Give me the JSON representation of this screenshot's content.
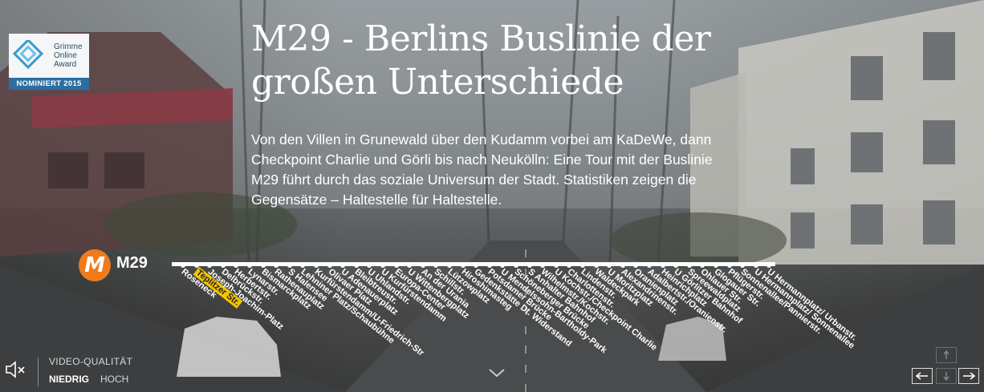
{
  "logo": {
    "line1": "Grimme",
    "line2": "Online",
    "line3": "Award",
    "badge": "NOMINIERT 2015",
    "color_blue": "#2c6ea3"
  },
  "hero": {
    "title": "M29 - Berlins Buslinie der großen Unterschiede",
    "intro": "Von den Villen in Grunewald über den Kudamm vorbei am KaDeWe, dann Checkpoint Charlie und Görli bis nach Neukölln: Eine Tour mit der Buslinie M29 führt durch das soziale Universum der Stadt. Statistiken zeigen die Gegensätze – Haltestelle für Haltestelle."
  },
  "route": {
    "badge_letter": "M",
    "line_name": "M29",
    "accent_color": "#f07b1d",
    "highlight_color": "#f5c400",
    "current_stop": "Teplitzer Str.",
    "stops": [
      "Roseneck",
      "Teplitzer Str.",
      "Joseph-Joachim-Platz",
      "Delbrückstr.",
      "Herbertstr.",
      "Lynarstr.",
      "Bismarckplatz",
      "Rathenauplatz",
      "S Halensee",
      "Lehniner Platz/Schaubühne",
      "Kurfürstendamm/U-Friedrich-Str",
      "Olivaer Platz",
      "U Adenauerplatz",
      "Bleibtreustr.",
      "U Uhlandstr.",
      "U Kurfürstendamm",
      "Europa-Center",
      "U Wittenbergplatz",
      "An der Urania",
      "Schillstr.",
      "Lützowplatz",
      "Hiroshimasteg",
      "Gedenkstätte Dt. Widerstand",
      "Potsdamer Brücke",
      "U Mendelssohn-Bartholdy-Park",
      "Schöneberger Brücke",
      "S Anhalter Bahnhof",
      "Wilhelmstr./Kochstr.",
      "U Kochstr./Checkpoint Charlie",
      "Charlottenstr.",
      "Lindenstr.",
      "Waldeckpark",
      "U Moritzplatz",
      "Alexandrinenstr.",
      "Oranienplatz",
      "Adalbertstr./Oranienstr.",
      "Heinrichplatz",
      "U Görlitzer Bahnhof",
      "Spreewaldplatz",
      "Ohlauer Str.",
      "Glogauer Str.",
      "Pflügerstr.",
      "Sonnenallee/Pannierstr.",
      "U Hermannplatz/ Sonnenallee",
      "U Hermannplatz/ Urbanstr."
    ]
  },
  "controls": {
    "mute_icon": "speaker-mute-icon",
    "quality_label": "VIDEO-QUALITÄT",
    "quality_low": "NIEDRIG",
    "quality_high": "HOCH",
    "selected_quality": "NIEDRIG",
    "scroll_icon": "chevron-down-icon",
    "nav_icons": [
      "arrow-up-icon",
      "arrow-down-icon",
      "arrow-left-icon",
      "arrow-right-icon"
    ]
  }
}
